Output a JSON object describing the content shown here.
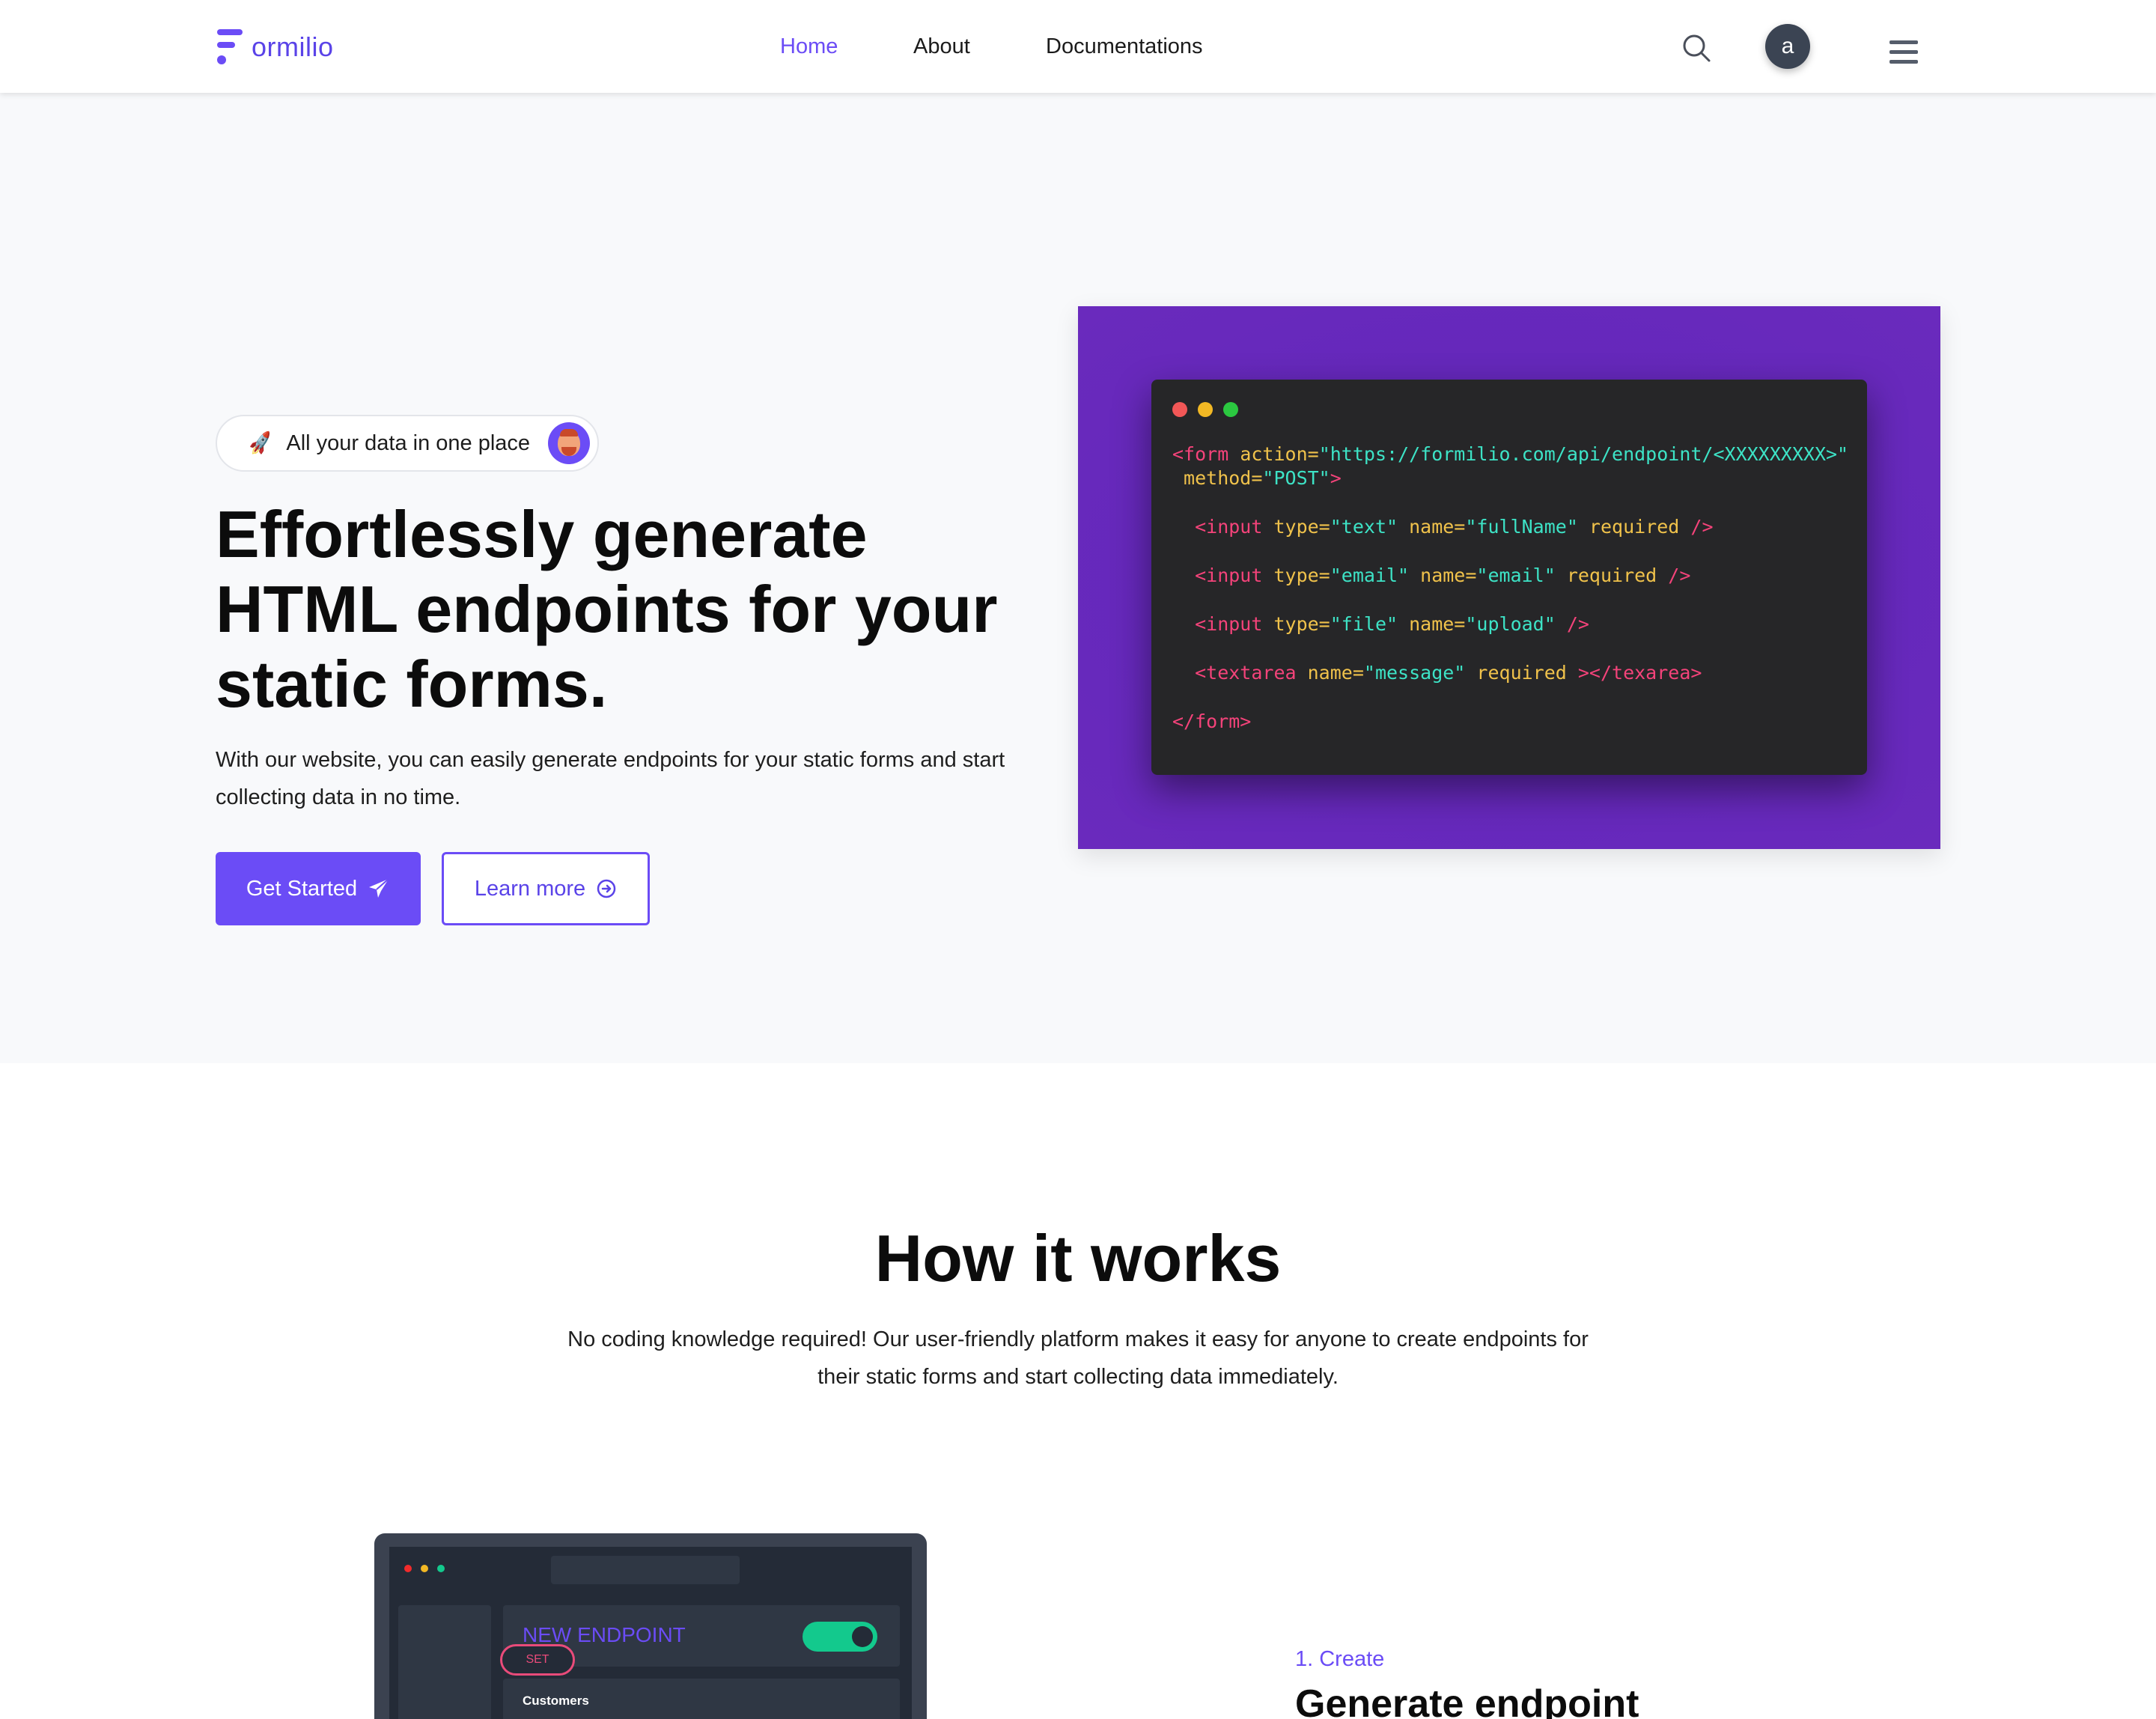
{
  "nav": {
    "brand": "ormilio",
    "links": [
      "Home",
      "About",
      "Documentations"
    ],
    "active": "Home",
    "avatar_letter": "a",
    "icons": {
      "search": "search-icon",
      "menu": "hamburger-menu-icon"
    }
  },
  "hero": {
    "badge_text": "All your data in one place",
    "title": "Effortlessly generate HTML endpoints for your static forms.",
    "subtitle": "With our website, you can easily generate endpoints for your static forms and start collecting data in no time.",
    "primary_button": "Get Started",
    "secondary_button": "Learn more"
  },
  "code": {
    "line1_tag_open": "<form",
    "line1_attr": " action=",
    "line1_val": "\"https://formilio.com/api/endpoint/<XXXXXXXXX>\"",
    "line2_attr": " method=",
    "line2_val": "\"POST\"",
    "line2_close": ">",
    "line3": [
      "  <input",
      " type=",
      "\"text\"",
      " name=",
      "\"fullName\"",
      " required",
      " />"
    ],
    "line4": [
      "  <input",
      " type=",
      "\"email\"",
      " name=",
      "\"email\"",
      " required",
      " />"
    ],
    "line5": [
      "  <input",
      " type=",
      "\"file\"",
      " name=",
      "\"upload\"",
      " />"
    ],
    "line6": [
      "  <textarea",
      " name=",
      "\"message\"",
      " required",
      " ></texarea>"
    ],
    "line7": "</form>"
  },
  "how": {
    "title": "How it works",
    "subtitle": "No coding knowledge required! Our user-friendly platform makes it easy for anyone to create endpoints for their static forms and start collecting data immediately."
  },
  "mockup": {
    "card_title": "NEW ENDPOINT",
    "set_label": "SET",
    "row_label": "Customers"
  },
  "step": {
    "number": "1. Create",
    "title": "Generate endpoint"
  },
  "colors": {
    "accent": "#6b4cf6",
    "code_bg_purple": "#6528bb",
    "code_tag": "#f4437a",
    "code_attr": "#f0c24b",
    "code_string": "#3de3c6"
  }
}
